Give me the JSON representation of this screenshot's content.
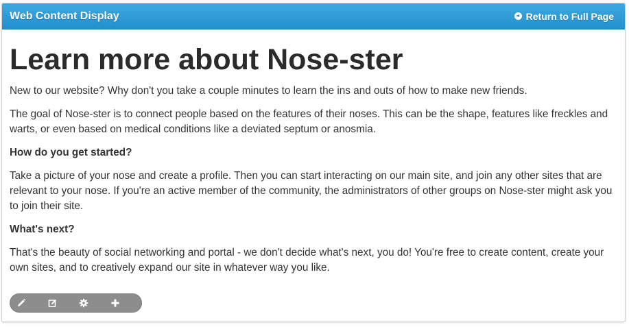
{
  "header": {
    "title": "Web Content Display",
    "return_label": "Return to Full Page"
  },
  "article": {
    "title": "Learn more about Nose-ster",
    "intro": "New to our website? Why don't you take a couple minutes to learn the ins and outs of how to make new friends.",
    "goal": "The goal of Nose-ster is to connect people based on the features of their noses. This can be the shape, features like freckles and warts, or even based on medical conditions like a deviated septum or anosmia.",
    "heading_started": "How do you get started?",
    "started_text": "Take a picture of your nose and create a profile. Then you can start interacting on our main site, and join any other sites that are relevant to your nose. If you're an active member of the community, the administrators of other groups on Nose-ster might ask you to join their site.",
    "heading_next": "What's next?",
    "next_text": "That's the beauty of social networking and portal - we don't decide what's next, you do! You're free to create content, create your own sites, and to creatively expand our site in whatever way you like."
  },
  "toolbar": {
    "icons": [
      "pencil-icon",
      "edit-box-icon",
      "gear-icon",
      "plus-icon"
    ]
  },
  "colors": {
    "header_bg": "#2a95d3",
    "toolbar_bg": "#8d8d8d",
    "text": "#333333"
  }
}
